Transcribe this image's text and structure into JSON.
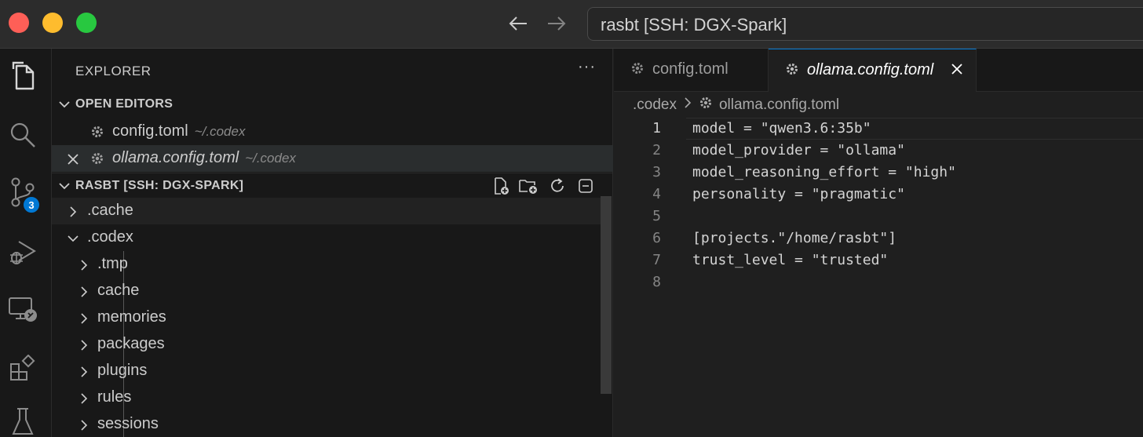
{
  "window": {
    "title": "rasbt [SSH: DGX-Spark]"
  },
  "activity_bar": {
    "items": [
      "files-icon",
      "search-icon",
      "source-control-icon",
      "run-debug-icon",
      "remote-explorer-icon",
      "extensions-icon",
      "testing-icon"
    ],
    "source_control_badge": "3"
  },
  "sidebar": {
    "title": "EXPLORER",
    "more": "···",
    "open_editors": {
      "header": "OPEN EDITORS",
      "items": [
        {
          "name": "config.toml",
          "path": "~/.codex"
        },
        {
          "name": "ollama.config.toml",
          "path": "~/.codex"
        }
      ]
    },
    "workspace": {
      "header": "RASBT [SSH: DGX-SPARK]",
      "tree": [
        {
          "name": ".cache"
        },
        {
          "name": ".codex"
        },
        {
          "name": ".tmp"
        },
        {
          "name": "cache"
        },
        {
          "name": "memories"
        },
        {
          "name": "packages"
        },
        {
          "name": "plugins"
        },
        {
          "name": "rules"
        },
        {
          "name": "sessions"
        }
      ]
    }
  },
  "editor": {
    "tabs": [
      {
        "label": "config.toml"
      },
      {
        "label": "ollama.config.toml"
      }
    ],
    "breadcrumb": [
      ".codex",
      "ollama.config.toml"
    ],
    "lines": [
      {
        "n": "1",
        "text": "model = \"qwen3.6:35b\""
      },
      {
        "n": "2",
        "text": "model_provider = \"ollama\""
      },
      {
        "n": "3",
        "text": "model_reasoning_effort = \"high\""
      },
      {
        "n": "4",
        "text": "personality = \"pragmatic\""
      },
      {
        "n": "5",
        "text": ""
      },
      {
        "n": "6",
        "text": "[projects.\"/home/rasbt\"]"
      },
      {
        "n": "7",
        "text": "trust_level = \"trusted\""
      },
      {
        "n": "8",
        "text": ""
      }
    ]
  }
}
